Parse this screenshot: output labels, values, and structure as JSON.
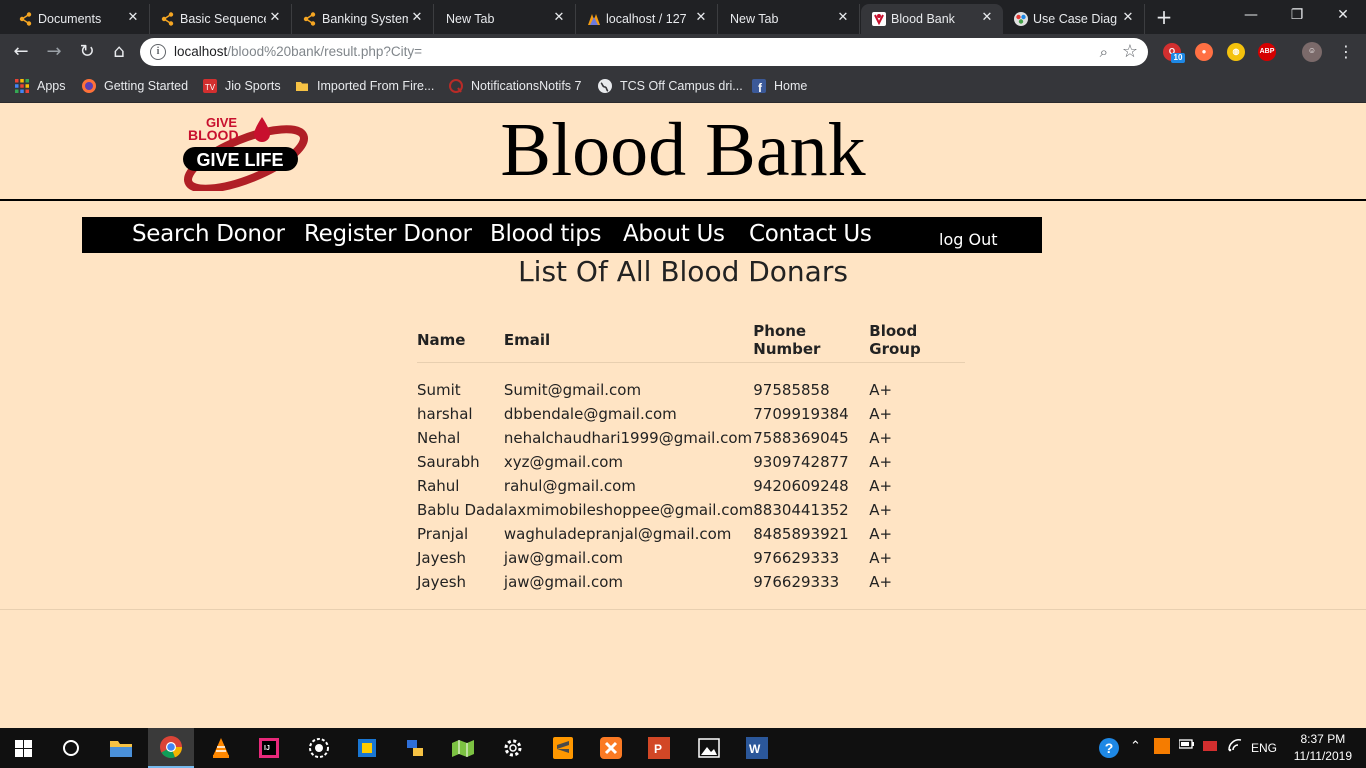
{
  "browser": {
    "tabs": [
      {
        "title": "Documents",
        "icon": "hub-icon"
      },
      {
        "title": "Basic Sequence",
        "icon": "hub-icon"
      },
      {
        "title": "Banking System",
        "icon": "hub-icon"
      },
      {
        "title": "New Tab",
        "icon": ""
      },
      {
        "title": "localhost / 127",
        "icon": "phpmyadmin-icon"
      },
      {
        "title": "New Tab",
        "icon": ""
      },
      {
        "title": "Blood Bank",
        "icon": "bloodbank-icon",
        "active": true
      },
      {
        "title": "Use Case Diag",
        "icon": "diagram-icon"
      }
    ],
    "url_host": "localhost",
    "url_path": "/blood%20bank/result.php?City=",
    "bookmarks": [
      {
        "label": "Apps"
      },
      {
        "label": "Getting Started"
      },
      {
        "label": "Jio Sports"
      },
      {
        "label": "Imported From Fire..."
      },
      {
        "label": "NotificationsNotifs 7"
      },
      {
        "label": "TCS Off Campus dri..."
      },
      {
        "label": "Home"
      }
    ],
    "extension_badge": "10",
    "abp_label": "ABP"
  },
  "site": {
    "logo_text_top": "GIVE",
    "logo_text_mid": "BLOOD",
    "logo_text_bottom": "GIVE LIFE",
    "title": "Blood Bank",
    "nav": [
      "Search Donor",
      "Register Donor",
      "Blood tips",
      "About Us",
      "Contact Us"
    ],
    "logout": "log Out",
    "list_heading": "List Of All Blood Donars",
    "table": {
      "headers": [
        "Name",
        "Email",
        "Phone Number",
        "Blood Group"
      ],
      "rows": [
        [
          "Sumit",
          "Sumit@gmail.com",
          "97585858",
          "A+"
        ],
        [
          "harshal",
          "dbbendale@gmail.com",
          "7709919384",
          "A+"
        ],
        [
          "Nehal",
          "nehalchaudhari1999@gmail.com",
          "7588369045",
          "A+"
        ],
        [
          "Saurabh",
          "xyz@gmail.com",
          "9309742877",
          "A+"
        ],
        [
          "Rahul",
          "rahul@gmail.com",
          "9420609248",
          "A+"
        ],
        [
          "Bablu Dada",
          "laxmimobileshoppee@gmail.com",
          "8830441352",
          "A+"
        ],
        [
          "Pranjal",
          "waghuladepranjal@gmail.com",
          "8485893921",
          "A+"
        ],
        [
          "Jayesh",
          "jaw@gmail.com",
          "976629333",
          "A+"
        ],
        [
          "Jayesh",
          "jaw@gmail.com",
          "976629333",
          "A+"
        ]
      ]
    }
  },
  "taskbar": {
    "language": "ENG",
    "time": "8:37 PM",
    "date": "11/11/2019"
  },
  "colors": {
    "page_bg": "#ffe4c4",
    "nav_bg": "#000000",
    "logo_red": "#c8102e"
  }
}
